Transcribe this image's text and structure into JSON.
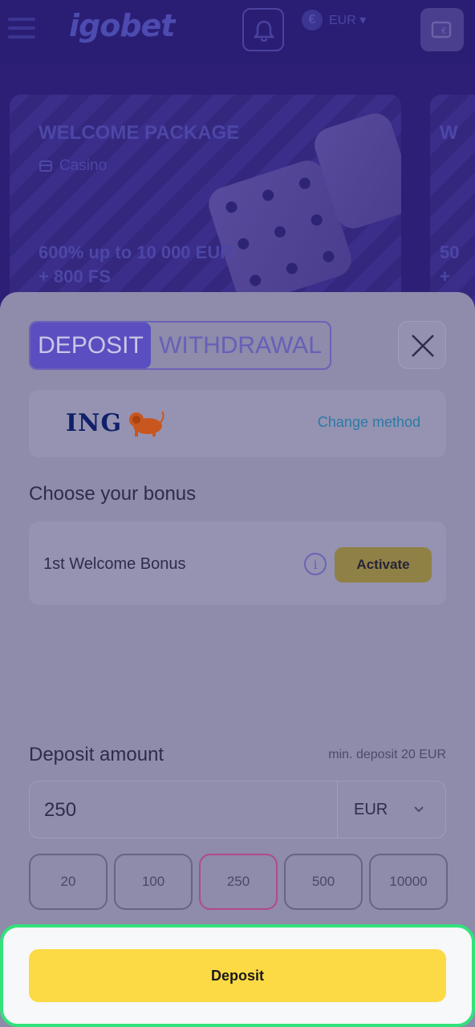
{
  "header": {
    "logo_text": "igobet",
    "currency_symbol": "€",
    "currency_label": "EUR ▾"
  },
  "promo": {
    "title": "WELCOME PACKAGE",
    "tag": "Casino",
    "offer_line1": "600% up to 10 000 EUR",
    "offer_line2": "+ 800 FS",
    "next_title_partial": "W",
    "next_offer_partial1": "50",
    "next_offer_partial2": "+"
  },
  "sheet": {
    "tabs": [
      {
        "label": "DEPOSIT",
        "active": true
      },
      {
        "label": "WITHDRAWAL",
        "active": false
      }
    ],
    "method": {
      "logo_text": "ING",
      "change_label": "Change method"
    },
    "bonus": {
      "title": "Choose your bonus",
      "item_label": "1st Welcome Bonus",
      "info_glyph": "i",
      "activate_label": "Activate"
    },
    "amount": {
      "title": "Deposit amount",
      "min_text": "min. deposit 20 EUR",
      "value": "250",
      "currency": "EUR"
    },
    "presets": [
      "20",
      "100",
      "250",
      "500",
      "10000"
    ],
    "selected_preset": "250",
    "deposit_label": "Deposit"
  },
  "colors": {
    "accent": "#5a4ec0",
    "deposit_button": "#fcda45",
    "highlight_border": "#32e27a"
  }
}
